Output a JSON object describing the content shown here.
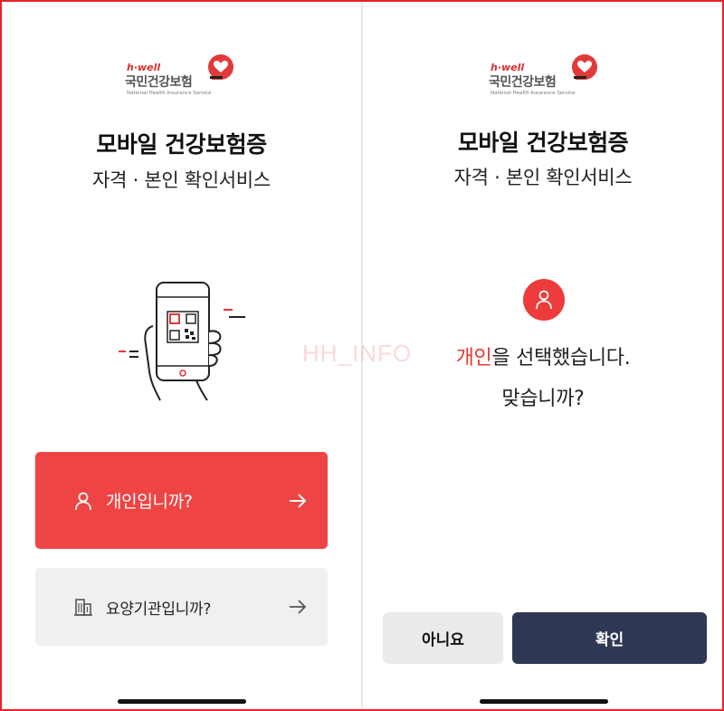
{
  "left": {
    "logo": {
      "brand": "h·well",
      "name_ko": "국민건강보험",
      "name_en": "National Health Insurance Service"
    },
    "title": "모바일 건강보험증",
    "subtitle": "자격 · 본인 확인서비스",
    "buttons": {
      "personal": {
        "label": "개인입니까?",
        "icon": "person-icon",
        "color": "#ef4444"
      },
      "institution": {
        "label": "요양기관입니까?",
        "icon": "building-icon",
        "color": "#f0f0f0"
      }
    }
  },
  "right": {
    "logo": {
      "brand": "h·well",
      "name_ko": "국민건강보험",
      "name_en": "National Health Insurance Service"
    },
    "title": "모바일 건강보험증",
    "subtitle": "자격 · 본인 확인서비스",
    "confirm": {
      "highlight": "개인",
      "line1_rest": "을 선택했습니다.",
      "line2": "맞습니까?"
    },
    "buttons": {
      "no": "아니요",
      "yes": "확인"
    }
  },
  "watermark": "HH_INFO",
  "colors": {
    "accent": "#ef4444",
    "confirm": "#2f3853",
    "frame": "#e8222b"
  }
}
